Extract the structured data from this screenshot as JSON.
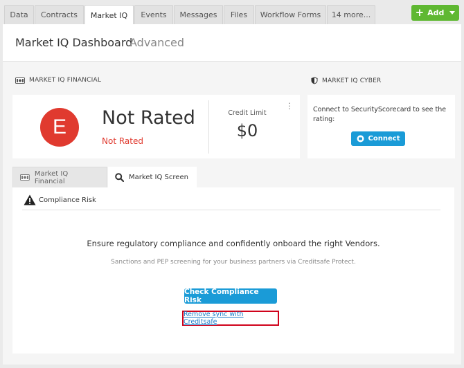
{
  "tabs": {
    "data": "Data",
    "contracts": "Contracts",
    "market_iq": "Market IQ",
    "events": "Events",
    "messages": "Messages",
    "files": "Files",
    "workflow_forms": "Workflow Forms",
    "more": "14 more..."
  },
  "add_button": {
    "label": "Add"
  },
  "header": {
    "title": "Market IQ Dashboard",
    "advanced": "Advanced"
  },
  "financial": {
    "section_label": "MARKET IQ FINANCIAL",
    "badge_letter": "E",
    "rating": "Not Rated",
    "rating_sub": "Not Rated",
    "credit_limit_label": "Credit Limit",
    "credit_limit_value": "$0",
    "menu_icon": "kebab-icon"
  },
  "cyber": {
    "section_label": "MARKET IQ CYBER",
    "description": "Connect to SecurityScorecard to see the rating:",
    "connect_label": "Connect"
  },
  "subtabs": {
    "financial": "Market IQ Financial",
    "screen": "Market IQ Screen"
  },
  "screen": {
    "compliance_label": "Compliance Risk",
    "main_message": "Ensure regulatory compliance and confidently onboard the right Vendors.",
    "sub_message": "Sanctions and PEP screening for your business partners via Creditsafe Protect.",
    "check_button": "Check Compliance Risk",
    "remove_link": "Remove sync with Creditsafe"
  },
  "colors": {
    "accent_blue": "#1a9bd7",
    "add_green": "#5fb832",
    "rating_red": "#e03a2f",
    "highlight_red": "#d0021b"
  }
}
